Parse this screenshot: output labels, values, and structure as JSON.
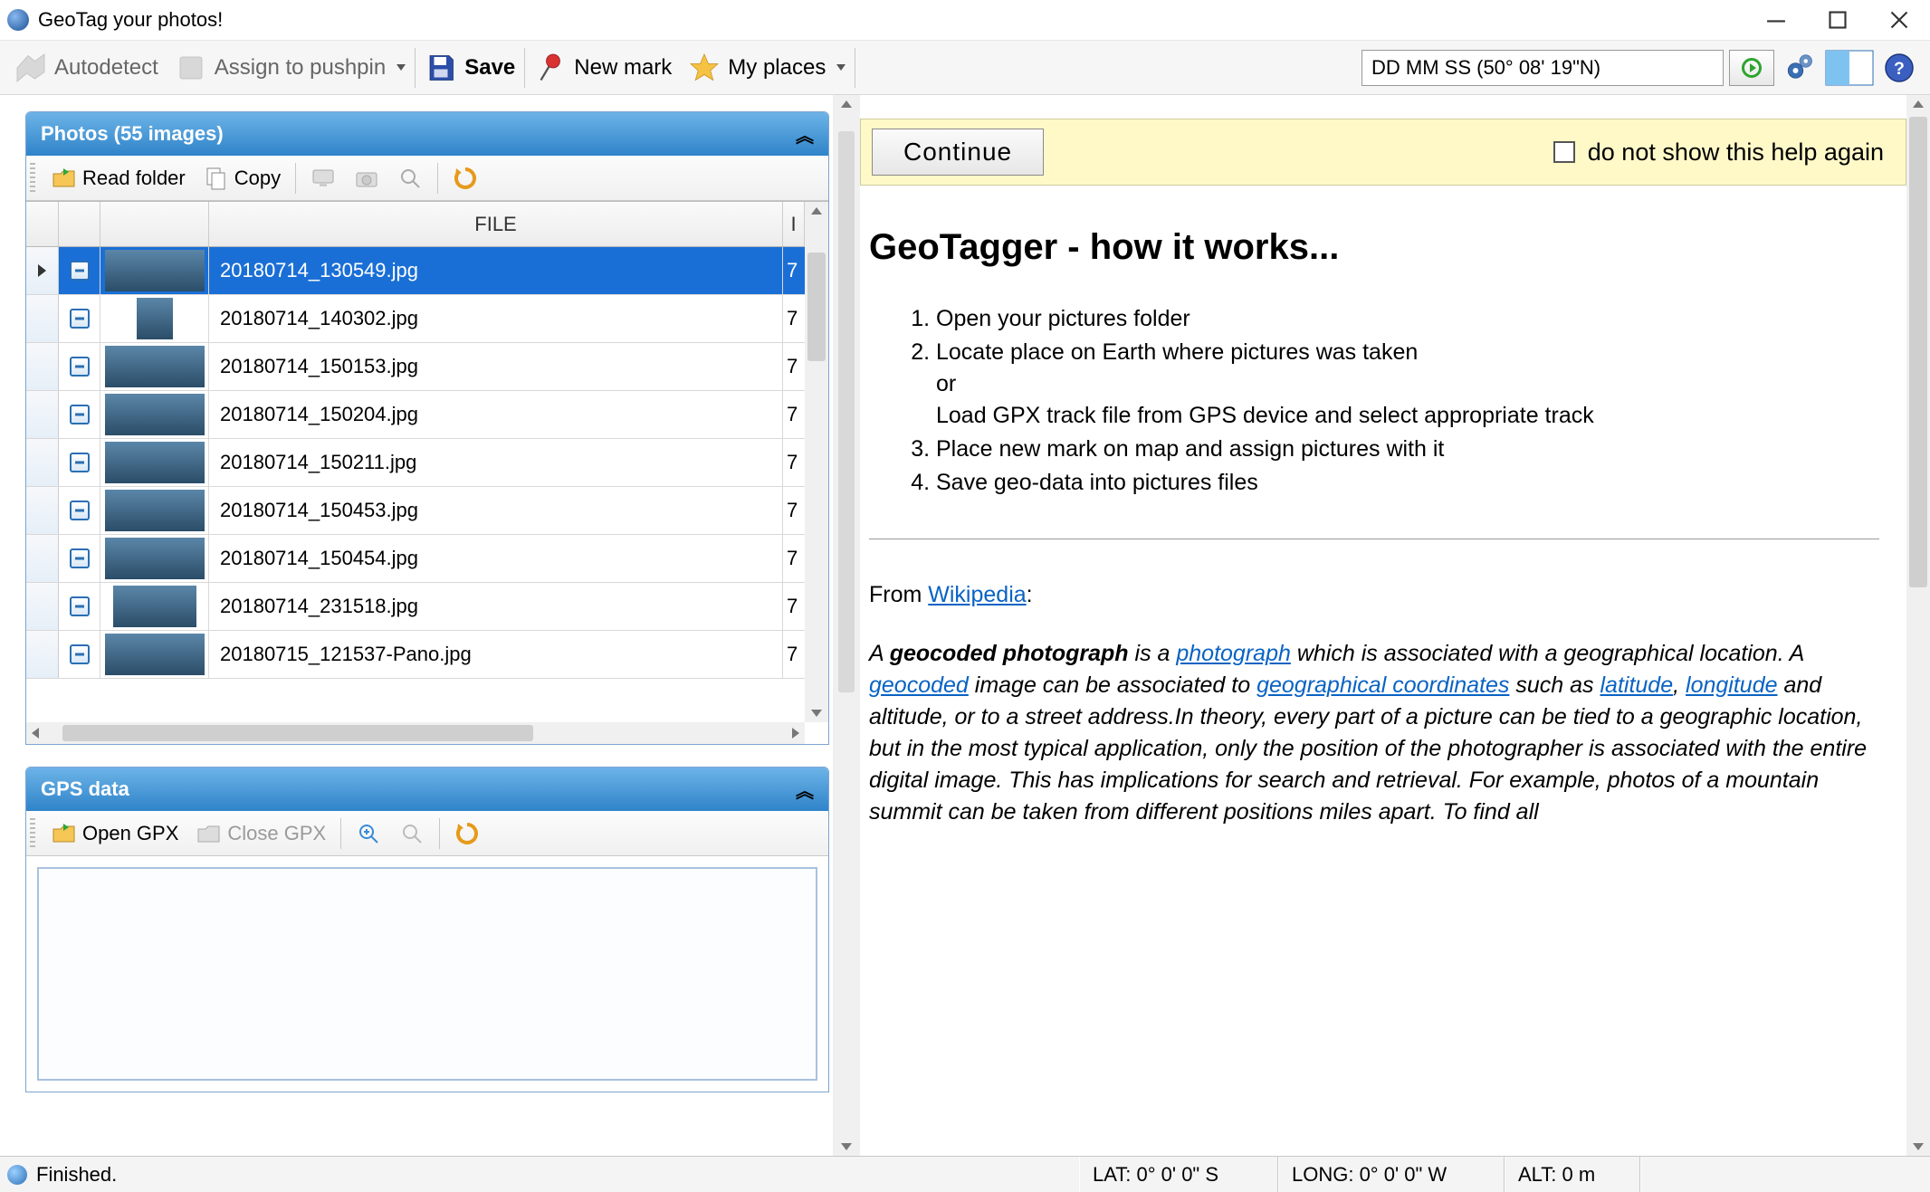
{
  "window": {
    "title": "GeoTag your photos!"
  },
  "toolbar": {
    "autodetect": "Autodetect",
    "assign_pushpin": "Assign to pushpin",
    "save": "Save",
    "new_mark": "New mark",
    "my_places": "My places",
    "coord_input": "DD MM SS (50° 08' 19\"N)"
  },
  "panels": {
    "photos": {
      "title": "Photos (55 images)",
      "tb": {
        "read_folder": "Read folder",
        "copy": "Copy"
      },
      "cols": {
        "file": "FILE",
        "extra": "I"
      },
      "rows": [
        {
          "file": "20180714_130549.jpg",
          "extra": "7",
          "selected": true,
          "thumb_w": "th-w1"
        },
        {
          "file": "20180714_140302.jpg",
          "extra": "7",
          "thumb_w": "th-w2"
        },
        {
          "file": "20180714_150153.jpg",
          "extra": "7",
          "thumb_w": "th-w1"
        },
        {
          "file": "20180714_150204.jpg",
          "extra": "7",
          "thumb_w": "th-w1"
        },
        {
          "file": "20180714_150211.jpg",
          "extra": "7",
          "thumb_w": "th-w1"
        },
        {
          "file": "20180714_150453.jpg",
          "extra": "7",
          "thumb_w": "th-w1"
        },
        {
          "file": "20180714_150454.jpg",
          "extra": "7",
          "thumb_w": "th-w1"
        },
        {
          "file": "20180714_231518.jpg",
          "extra": "7",
          "thumb_w": "th-w3"
        },
        {
          "file": "20180715_121537-Pano.jpg",
          "extra": "7",
          "thumb_w": "th-w1"
        }
      ]
    },
    "gps": {
      "title": "GPS data",
      "tb": {
        "open": "Open GPX",
        "close": "Close GPX"
      }
    }
  },
  "help": {
    "continue": "Continue",
    "dont_show": "do not show this help again",
    "heading": "GeoTagger - how it works...",
    "steps": {
      "s1": "Open your pictures folder",
      "s2a": "Locate place on Earth where pictures was taken",
      "s2or": "or",
      "s2b": "Load GPX track file from GPS device and select appropriate track",
      "s3": "Place new mark on map and assign pictures with it",
      "s4": "Save geo-data into pictures files"
    },
    "from": "From ",
    "wikipedia": "Wikipedia",
    "colon": ":",
    "para_pre": "A ",
    "para_b": "geocoded photograph",
    "para_mid1": " is a ",
    "link_photo": "photograph",
    "para_mid2": " which is associated with a geographical location. A ",
    "link_geocoded": "geocoded",
    "para_mid3": " image can be associated to ",
    "link_geocoord": "geographical coordinates",
    "para_mid4": " such as ",
    "link_lat": "latitude",
    "comma": ", ",
    "link_lon": "longitude",
    "para_tail": " and altitude, or to a street address.In theory, every part of a picture can be tied to a geographic location, but in the most typical application, only the position of the photographer is associated with the entire digital image. This has implications for search and retrieval. For example, photos of a mountain summit can be taken from different positions miles apart. To find all"
  },
  "status": {
    "message": "Finished.",
    "lat": "LAT:   0° 0' 0\" S",
    "lon": "LONG:   0° 0' 0\" W",
    "alt": "ALT: 0 m"
  }
}
